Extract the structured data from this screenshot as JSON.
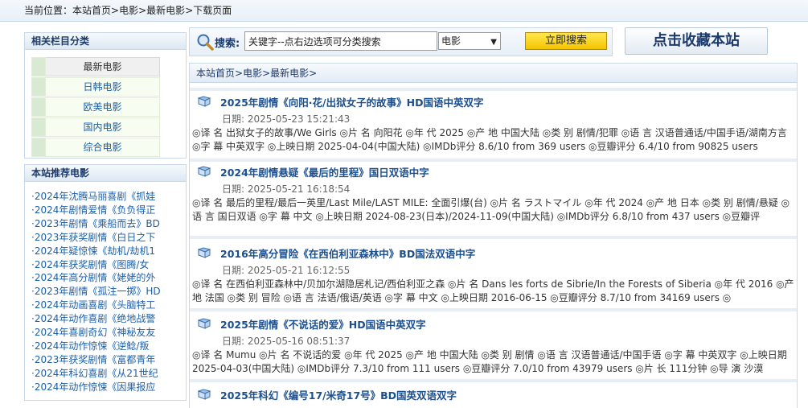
{
  "location": {
    "label": "当前位置：",
    "crumbs": [
      "本站首页",
      "电影",
      "最新电影",
      "下载页面"
    ],
    "sep": ">"
  },
  "sidebar": {
    "categories": {
      "title": "相关栏目分类",
      "items": [
        "最新电影",
        "日韩电影",
        "欧美电影",
        "国内电影",
        "综合电影"
      ]
    },
    "recommended": {
      "title": "本站推荐电影",
      "items": [
        "·2024年沈腾马丽喜剧《抓娃",
        "·2024年剧情爱情《负负得正",
        "·2023年剧情《乘船而去》BD",
        "·2023年获奖剧情《白日之下",
        "·2024年疑惊悚《劫机/劫机1",
        "·2024年获奖剧情《图腾/女",
        "·2024年高分剧情《姥姥的外",
        "·2023年剧情《孤注一掷》HD",
        "·2024年动画喜剧《头脑特工",
        "·2024年动作喜剧《绝地战警",
        "·2024年喜剧奇幻《神秘友友",
        "·2024年动作惊悚《逆鲶/叛",
        "·2023年获奖剧情《富都青年",
        "·2024年科幻喜剧《从21世纪",
        "·2024年动作惊悚《因果报应"
      ]
    }
  },
  "search": {
    "label": "搜索:",
    "input_value": "关键字--点右边选项可分类搜索",
    "select_value": "电影",
    "button_label": "立即搜索"
  },
  "bookmark_label": "点击收藏本站",
  "main": {
    "crumbs": [
      "本站首页",
      "电影",
      "最新电影"
    ],
    "items": [
      {
        "title": "2025年剧情《向阳·花/出狱女子的故事》HD国语中英双字",
        "date": "日期:  2025-05-23 15:21:43",
        "desc": "◎译 名 出狱女子的故事/We Girls ◎片 名 向阳花 ◎年 代 2025 ◎产 地 中国大陆 ◎类 别 剧情/犯罪 ◎语 言 汉语普通话/中国手语/湖南方言 ◎字 幕 中英双字 ◎上映日期 2025-04-04(中国大陆) ◎IMDb评分 8.6/10 from 369 users ◎豆瓣评分 6.4/10 from 90825 users"
      },
      {
        "title": "2024年剧情悬疑《最后的里程》国日双语中字",
        "date": "日期:  2025-05-21 16:18:54",
        "desc": "◎译 名 最后的里程/最后一英里/Last Mile/LAST MILE: 全面引爆(台) ◎片 名 ラストマイル ◎年 代 2024 ◎产 地 日本 ◎类 别 剧情/悬疑 ◎语 言 国日双语 ◎字 幕 中文 ◎上映日期 2024-08-23(日本)/2024-11-09(中国大陆) ◎IMDb评分 6.8/10 from 437 users ◎豆瓣评"
      },
      {
        "title": "2016年高分冒险《在西伯利亚森林中》BD国法双语中字",
        "date": "日期:  2025-05-21 16:12:55",
        "desc": "◎译 名 在西伯利亚森林中/贝加尔湖隐居札记/西伯利亚之森 ◎片 名 Dans les forts de Sibrie/In the Forests of Siberia ◎年 代 2016 ◎产 地 法国 ◎类 别 冒险 ◎语 言 法语/俄语/英语 ◎字 幕 中文 ◎上映日期 2016-06-15 ◎豆瓣评分 8.7/10 from 34169 users ◎"
      },
      {
        "title": "2025年剧情《不说话的爱》HD国语中英双字",
        "date": "日期:  2025-05-16 08:51:37",
        "desc": "◎译 名 Mumu ◎片 名 不说话的爱 ◎年 代 2025 ◎产 地 中国大陆 ◎类 别 剧情 ◎语 言 汉语普通话/中国手语 ◎字 幕 中英双字 ◎上映日期 2025-04-03(中国大陆) ◎IMDb评分 7.3/10 from 111 users ◎豆瓣评分 7.0/10 from 43979 users ◎片 长 111分钟 ◎导 演 沙漠"
      },
      {
        "title": "2025年科幻《编号17/米奇17号》BD国英双语双字",
        "date": "",
        "desc": ""
      }
    ]
  }
}
